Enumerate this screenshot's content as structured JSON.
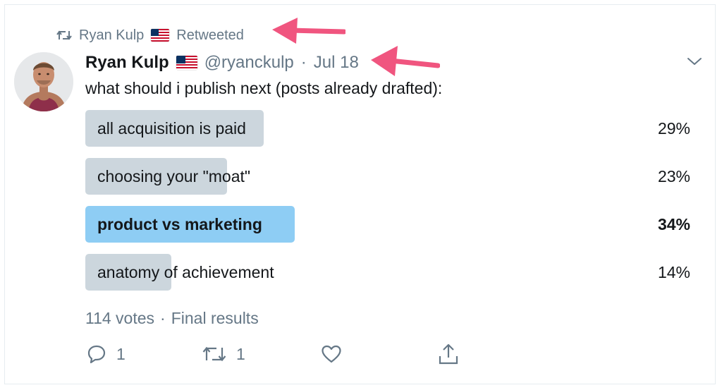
{
  "context": {
    "retweeter_name": "Ryan Kulp",
    "retweeted_label": "Retweeted"
  },
  "tweet": {
    "display_name": "Ryan Kulp",
    "handle": "@ryanckulp",
    "separator": "·",
    "date": "Jul 18",
    "text": "what should i publish next (posts already drafted):"
  },
  "poll": {
    "options": [
      {
        "label": "all acquisition is paid",
        "percent_text": "29%",
        "percent": 29,
        "winner": false
      },
      {
        "label": "choosing your \"moat\"",
        "percent_text": "23%",
        "percent": 23,
        "winner": false
      },
      {
        "label": "product vs marketing",
        "percent_text": "34%",
        "percent": 34,
        "winner": true
      },
      {
        "label": "anatomy of achievement",
        "percent_text": "14%",
        "percent": 14,
        "winner": false
      }
    ],
    "votes": "114 votes",
    "separator": "·",
    "status": "Final results"
  },
  "actions": {
    "reply_count": "1",
    "retweet_count": "1"
  },
  "colors": {
    "arrow": "#f0557f",
    "bar": "#ccd6dd",
    "bar_winner": "#8ecdf4",
    "muted_text": "#657786"
  },
  "icons": {
    "retweet": "retweet-icon",
    "flag": "us-flag-icon",
    "caret": "chevron-down-icon",
    "reply": "reply-icon",
    "like": "heart-icon",
    "share": "share-icon"
  }
}
